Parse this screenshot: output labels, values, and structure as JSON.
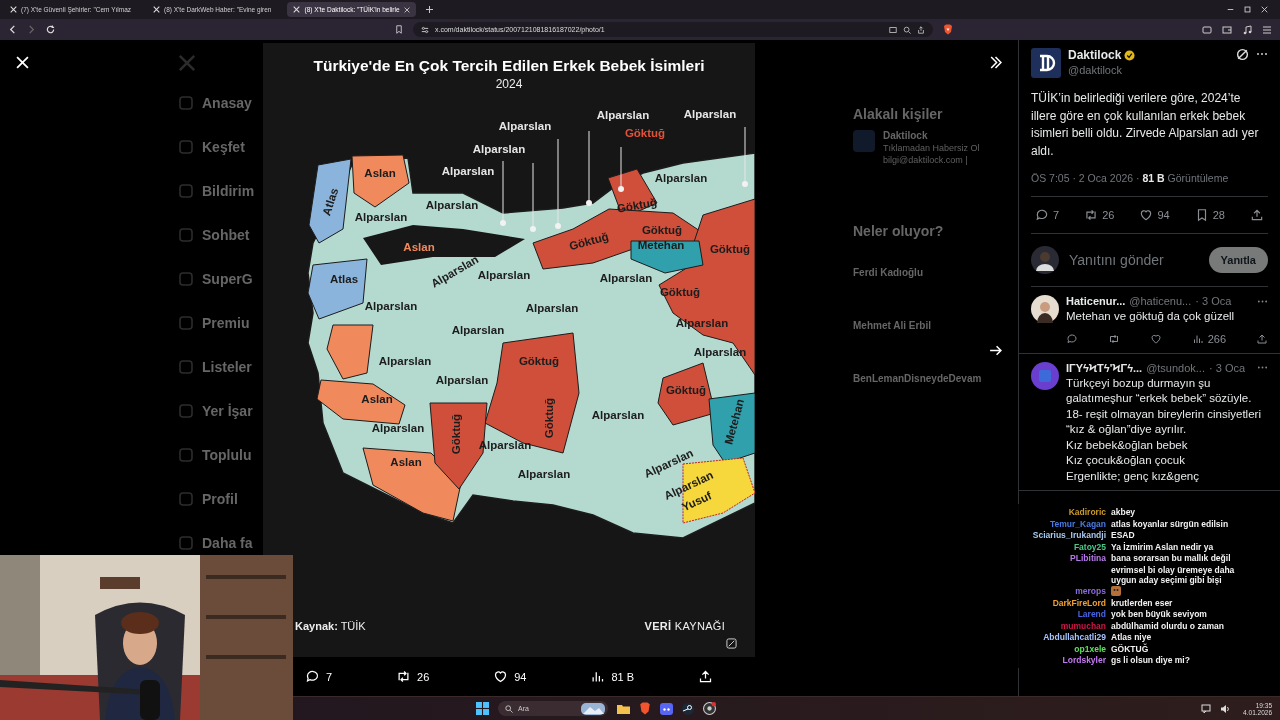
{
  "browser": {
    "tabs": [
      {
        "title": "(7) X'te Güvenli Şehirler: \"Cem Yılmaz",
        "selected": false
      },
      {
        "title": "(8) X'te DarkWeb Haber: \"Evine giren",
        "selected": false
      },
      {
        "title": "(8) X'te Daktilock: \"TÜİK'in belirle",
        "selected": true
      }
    ],
    "url": "x.com/daktilock/status/2007121081816187022/photo/1"
  },
  "x_sidebar": {
    "items": [
      "Anasay",
      "Keşfet",
      "Bildirim",
      "Sohbet",
      "SuperG",
      "Premiu",
      "Listeler",
      "Yer İşar",
      "Toplulu",
      "Profil",
      "Daha fa"
    ]
  },
  "dim_panel": {
    "related_heading": "Alakalı kişiler",
    "related_name": "Daktilock",
    "related_bio": "Tıklamadan Habersiz Ol",
    "related_mail": "bilgi@daktilock.com |",
    "trends_heading": "Neler oluyor?",
    "trends": [
      "Ferdi Kadıoğlu",
      "Mehmet Ali Erbil",
      "BenLemanDisneydeDevam"
    ]
  },
  "photo": {
    "title": "Türkiye'de En Çok Tercih Edilen Erkek Bebek İsimleri",
    "year": "2024",
    "labels": [
      {
        "text": "Alparslan",
        "color": "#e6e6e6"
      },
      {
        "text": "Alparslan",
        "color": "#e6e6e6"
      },
      {
        "text": "Göktuğ",
        "color": "#e0533a"
      },
      {
        "text": "Alparslan",
        "color": "#e6e6e6"
      },
      {
        "text": "Alparslan",
        "color": "#e6e6e6"
      },
      {
        "text": "Alparslan",
        "color": "#e6e6e6"
      },
      {
        "text": "Aslan",
        "color": "#1c1c1c"
      },
      {
        "text": "Atlas",
        "color": "#1c1c1c"
      },
      {
        "text": "Alparslan",
        "color": "#1c1c1c"
      },
      {
        "text": "Alparslan",
        "color": "#1c1c1c"
      },
      {
        "text": "Alparslan",
        "color": "#1c1c1c"
      },
      {
        "text": "Göktuğ",
        "color": "#1c1c1c"
      },
      {
        "text": "Göktuğ",
        "color": "#1c1c1c"
      },
      {
        "text": "Aslan",
        "color": "#f08a5d"
      },
      {
        "text": "Göktuğ",
        "color": "#1c1c1c"
      },
      {
        "text": "Metehan",
        "color": "#1c1c1c"
      },
      {
        "text": "Göktuğ",
        "color": "#1c1c1c"
      },
      {
        "text": "Atlas",
        "color": "#1c1c1c"
      },
      {
        "text": "Alparslan",
        "color": "#1c1c1c"
      },
      {
        "text": "Alparslan",
        "color": "#1c1c1c"
      },
      {
        "text": "Alparslan",
        "color": "#1c1c1c"
      },
      {
        "text": "Göktuğ",
        "color": "#1c1c1c"
      },
      {
        "text": "Alparslan",
        "color": "#1c1c1c"
      },
      {
        "text": "Alparslan",
        "color": "#1c1c1c"
      },
      {
        "text": "Alparslan",
        "color": "#1c1c1c"
      },
      {
        "text": "Alparslan",
        "color": "#1c1c1c"
      },
      {
        "text": "Alparslan",
        "color": "#1c1c1c"
      },
      {
        "text": "Alparslan",
        "color": "#1c1c1c"
      },
      {
        "text": "Göktuğ",
        "color": "#1c1c1c"
      },
      {
        "text": "Alparslan",
        "color": "#1c1c1c"
      },
      {
        "text": "Göktuğ",
        "color": "#1c1c1c"
      },
      {
        "text": "Aslan",
        "color": "#1c1c1c"
      },
      {
        "text": "Göktuğ",
        "color": "#1c1c1c"
      },
      {
        "text": "Göktuğ",
        "color": "#1c1c1c"
      },
      {
        "text": "Alparslan",
        "color": "#1c1c1c"
      },
      {
        "text": "Metehan",
        "color": "#1c1c1c"
      },
      {
        "text": "Alparslan",
        "color": "#1c1c1c"
      },
      {
        "text": "Alparslan",
        "color": "#1c1c1c"
      },
      {
        "text": "Aslan",
        "color": "#1c1c1c"
      },
      {
        "text": "Alparslan",
        "color": "#1c1c1c"
      },
      {
        "text": "Alparslan",
        "color": "#1c1c1c"
      },
      {
        "text": "Alparslan",
        "color": "#1c1c1c"
      },
      {
        "text": "Yusuf",
        "color": "#1c1c1c"
      }
    ],
    "source": "**Kaynak:** TÜİK",
    "brand": "**VERİ** KAYNAĞI"
  },
  "photo_actions": [
    {
      "kind": "reply",
      "count": "7"
    },
    {
      "kind": "repost",
      "count": "26"
    },
    {
      "kind": "like",
      "count": "94"
    },
    {
      "kind": "views",
      "count": "81 B"
    },
    {
      "kind": "share"
    }
  ],
  "post": {
    "name": "Daktilock",
    "handle": "@daktilock",
    "text": "TÜİK’in belirlediği verilere göre, 2024’te illere göre en çok kullanılan erkek bebek isimleri belli oldu. Zirvede Alparslan adı yer aldı.",
    "meta": "ÖS 7:05 · 2 Oca 2026 · **81 B** Görüntüleme",
    "actions": [
      {
        "kind": "reply",
        "count": "7"
      },
      {
        "kind": "repost",
        "count": "26"
      },
      {
        "kind": "like",
        "count": "94"
      },
      {
        "kind": "bookmark",
        "count": "28"
      },
      {
        "kind": "share"
      }
    ]
  },
  "reply_box": {
    "placeholder": "Yanıtını gönder",
    "button": "Yanıtla"
  },
  "replies": [
    {
      "name": "Haticenur...",
      "handle": "@haticenu...",
      "date": "· 3 Oca",
      "text": "Metehan ve göktuğ da çok güzell",
      "actions": [
        {
          "kind": "reply"
        },
        {
          "kind": "repost"
        },
        {
          "kind": "like"
        },
        {
          "kind": "views",
          "count": "266"
        },
        {
          "kind": "share"
        }
      ]
    },
    {
      "name": "ΙΓΥϟϞΤϟ'ϞΓϟ...",
      "handle": "@tsundok...",
      "date": "· 3 Oca",
      "text": "Türkçeyi bozup durmayın şu galatımeşhur “erkek bebek” sözüyle.\n18- reşit olmayan bireylerin cinsiyetleri “kız & oğlan”diye ayrılır.\nKız bebek&oğlan bebek\nKız çocuk&oğlan çocuk\nErgenlikte; genç kız&genç"
    }
  ],
  "chat": [
    {
      "name": "Kadiroric",
      "message": "akbey",
      "color": "#c89a2a"
    },
    {
      "name": "Temur_Kagan",
      "message": "atlas koyanlar sürgün edilsin",
      "color": "#4a7ae0"
    },
    {
      "name": "Sciarius_Irukandji",
      "message": "ESAD",
      "color": "#a8c8f0"
    },
    {
      "name": "Fatoy25",
      "message": "Ya İzmirim Aslan nedir ya",
      "color": "#4cc88a"
    },
    {
      "name": "PLibitina",
      "message": "bana sorarsan bu mallık değil",
      "color": "#b57ae8"
    },
    {
      "message": "evrimsel bi olay üremeye daha uygun aday seçimi gibi bişi"
    },
    {
      "name": "merops",
      "color": "#8a6ae0",
      "emote": true
    },
    {
      "name": "DarkFireLord",
      "message": "krutlerden eser",
      "color": "#f0a030"
    },
    {
      "name": "Larend",
      "message": "yok ben büyük seviyom",
      "color": "#4a64e0"
    },
    {
      "name": "mumuchan",
      "message": "abdülhamid olurdu o zaman",
      "color": "#d0164a"
    },
    {
      "name": "Abdullahcatli29",
      "message": "Atlas niye",
      "color": "#a8c4ff"
    },
    {
      "name": "op1xele",
      "message": "GÖKTUĞ",
      "color": "#5ee05e"
    },
    {
      "name": "Lordskyler",
      "message": "gs li olsun diye mi?",
      "color": "#c47af0"
    }
  ],
  "taskbar": {
    "search_placeholder": "Ara",
    "time": "19:35",
    "date": "4.01.2026"
  }
}
